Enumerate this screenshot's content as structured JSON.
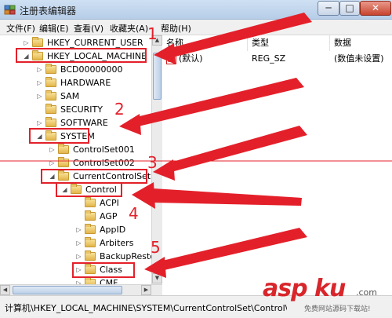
{
  "window": {
    "title": "注册表编辑器",
    "minimize": "─",
    "maximize": "□",
    "close": "✕"
  },
  "menu": [
    "文件(F)",
    "编辑(E)",
    "查看(V)",
    "收藏夹(A)",
    "帮助(H)"
  ],
  "tree": [
    {
      "label": "HKEY_CURRENT_USER",
      "expander": "▷",
      "level": 0
    },
    {
      "label": "HKEY_LOCAL_MACHINE",
      "expander": "◢",
      "level": 0
    },
    {
      "label": "BCD00000000",
      "expander": "▷",
      "level": 1
    },
    {
      "label": "HARDWARE",
      "expander": "▷",
      "level": 1
    },
    {
      "label": "SAM",
      "expander": "▷",
      "level": 1
    },
    {
      "label": "SECURITY",
      "expander": "",
      "level": 1
    },
    {
      "label": "SOFTWARE",
      "expander": "▷",
      "level": 1
    },
    {
      "label": "SYSTEM",
      "expander": "◢",
      "level": 1
    },
    {
      "label": "ControlSet001",
      "expander": "▷",
      "level": 2
    },
    {
      "label": "ControlSet002",
      "expander": "▷",
      "level": 2
    },
    {
      "label": "CurrentControlSet",
      "expander": "◢",
      "level": 2
    },
    {
      "label": "Control",
      "expander": "◢",
      "level": 3
    },
    {
      "label": "ACPI",
      "expander": "",
      "level": 4
    },
    {
      "label": "AGP",
      "expander": "",
      "level": 4
    },
    {
      "label": "AppID",
      "expander": "▷",
      "level": 4
    },
    {
      "label": "Arbiters",
      "expander": "▷",
      "level": 4
    },
    {
      "label": "BackupResto",
      "expander": "▷",
      "level": 4
    },
    {
      "label": "Class",
      "expander": "▷",
      "level": 4
    },
    {
      "label": "CMF",
      "expander": "▷",
      "level": 4
    }
  ],
  "columns": {
    "name": "名称",
    "type": "类型",
    "data": "数据"
  },
  "values": [
    {
      "name": "(默认)",
      "type": "REG_SZ",
      "data": "(数值未设置)",
      "icon": "ab"
    }
  ],
  "status": "计算机\\HKEY_LOCAL_MACHINE\\SYSTEM\\CurrentControlSet\\Control\\Class",
  "annotations": {
    "steps": [
      "1",
      "2",
      "3",
      "4",
      "5"
    ],
    "color": "#e3202a"
  },
  "watermark": {
    "brand": "asp ku",
    "tld": ".com",
    "slogan": "免费网站源码下载站!"
  }
}
